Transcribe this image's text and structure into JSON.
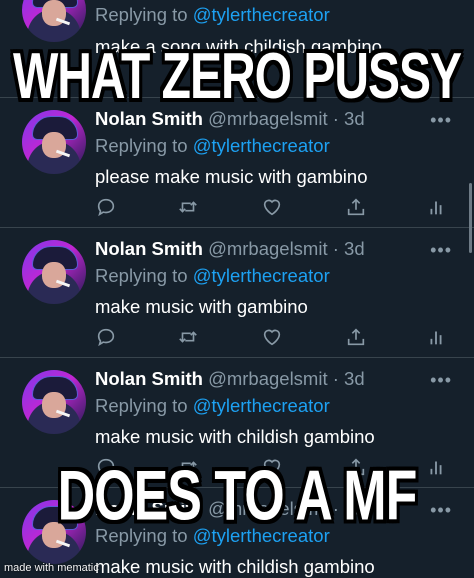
{
  "tweets": [
    {
      "reply_prefix": "Replying to ",
      "reply_mention": "@tylerthecreator",
      "text": "make a song with childish gambino",
      "more": "•••"
    },
    {
      "name": "Nolan Smith",
      "handle": "@mrbagelsmit",
      "sep": " · ",
      "time": "3d",
      "reply_prefix": "Replying to ",
      "reply_mention": "@tylerthecreator",
      "text": "please make music with gambino",
      "more": "•••"
    },
    {
      "name": "Nolan Smith",
      "handle": "@mrbagelsmit",
      "sep": " · ",
      "time": "3d",
      "reply_prefix": "Replying to ",
      "reply_mention": "@tylerthecreator",
      "text": "make music with gambino",
      "more": "•••"
    },
    {
      "name": "Nolan Smith",
      "handle": "@mrbagelsmit",
      "sep": " · ",
      "time": "3d",
      "reply_prefix": "Replying to ",
      "reply_mention": "@tylerthecreator",
      "text": "make music with childish gambino",
      "more": "•••"
    },
    {
      "name": "Nolan Smith",
      "handle": "@mrbagelsmit",
      "sep": " · ",
      "time": "3d",
      "reply_prefix": "Replying to ",
      "reply_mention": "@tylerthecreator",
      "text": "make music with childish gambino",
      "more": "•••"
    }
  ],
  "action_icons": [
    "reply-icon",
    "retweet-icon",
    "like-icon",
    "share-icon",
    "analytics-icon"
  ],
  "meme": {
    "top": "WHAT ZERO PUSSY",
    "bottom": "DOES TO A MF"
  },
  "watermark": "made with mematic",
  "colors": {
    "background": "#15202b",
    "secondary_text": "#8899a6",
    "mention": "#1da1f2",
    "divider": "#38444d"
  }
}
